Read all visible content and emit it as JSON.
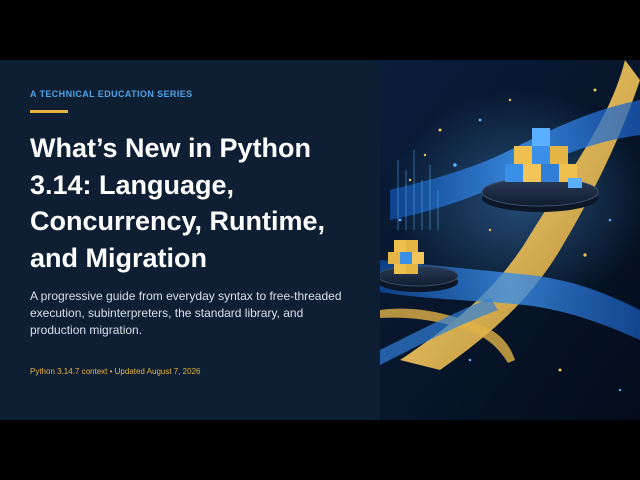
{
  "slide": {
    "kicker": "A TECHNICAL EDUCATION SERIES",
    "title": "What’s New in Python 3.14: Language, Concurrency, Runtime, and Migration",
    "subtitle": "A progressive guide from everyday syntax to free-threaded execution, subinterpreters, the standard library, and production migration.",
    "meta": "Python 3.14.7 context • Updated August 7, 2026"
  },
  "colors": {
    "panel": "#0e1f34",
    "accent_blue": "#4fa3e6",
    "accent_gold": "#e3b23c",
    "art_background": "#061226"
  }
}
